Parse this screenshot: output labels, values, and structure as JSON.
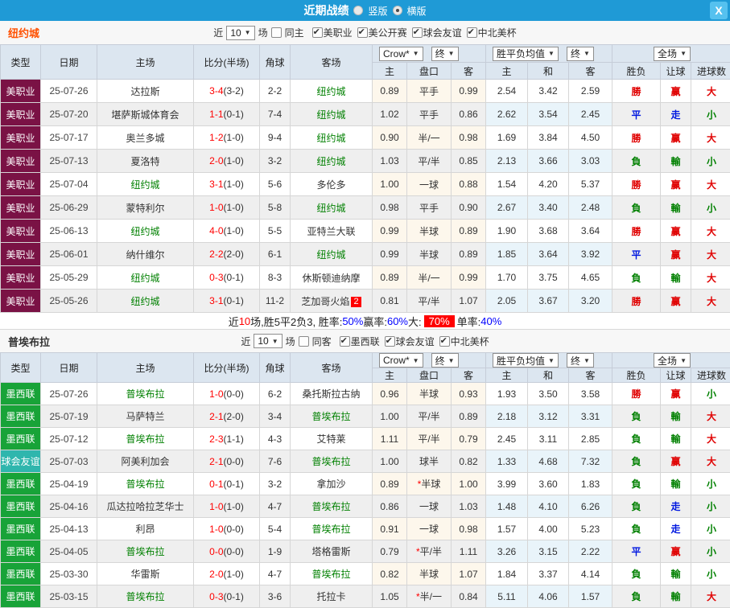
{
  "colors": {
    "titlebar_bg": "#1F9AD6",
    "close_bg": "#55C1EF",
    "header_bg": "#DCE6F0",
    "type_mls": "#7A1245",
    "type_ligamx": "#18A338",
    "type_friendly": "#2FB6AD",
    "team_highlight": "#008000",
    "score_red": "#FF0000",
    "win_red": "#E00000",
    "draw_blue": "#0018E0",
    "lose_green": "#008000",
    "rate_blue": "#0000FF",
    "big_rate_badge_bg": "#FF0000"
  },
  "titlebar": {
    "title": "近期战绩",
    "vertical_label": "竖版",
    "vertical_checked": false,
    "horizontal_label": "横版",
    "horizontal_checked": true,
    "close_glyph": "X"
  },
  "table_header": {
    "cols": [
      "类型",
      "日期",
      "主场",
      "比分(半场)",
      "角球",
      "客场"
    ],
    "sub": [
      "主",
      "盘口",
      "客",
      "主",
      "和",
      "客",
      "胜负",
      "让球",
      "进球数"
    ],
    "company_select": "Crow*",
    "final_select": "终",
    "mean_select": "胜平负均值",
    "final_select2": "终",
    "scope_select": "全场"
  },
  "sections": [
    {
      "team": "纽约城",
      "team_color": "#FF5000",
      "filter": {
        "near": "近",
        "count": "10",
        "games": "场",
        "same": "同主",
        "same_checked": false,
        "leagues": [
          {
            "label": "美职业",
            "checked": true
          },
          {
            "label": "美公开赛",
            "checked": true
          },
          {
            "label": "球会友谊",
            "checked": true
          },
          {
            "label": "中北美杯",
            "checked": true
          }
        ]
      },
      "rows": [
        {
          "type": "美职业",
          "tc": "type_mls",
          "date": "25-07-26",
          "home": "达拉斯",
          "home_hl": false,
          "score": "3-4",
          "half": "(3-2)",
          "corner": "2-2",
          "away": "纽约城",
          "away_hl": true,
          "away_badge": "",
          "odds": {
            "h": "0.89",
            "pk": "平手",
            "a": "0.99",
            "star": false
          },
          "means": [
            "2.54",
            "3.42",
            "2.59"
          ],
          "res": [
            [
              "勝",
              "r"
            ],
            [
              "赢",
              "r"
            ],
            [
              "大",
              "r"
            ]
          ]
        },
        {
          "type": "美职业",
          "tc": "type_mls",
          "date": "25-07-20",
          "home": "堪萨斯城体育会",
          "home_hl": false,
          "score": "1-1",
          "half": "(0-1)",
          "corner": "7-4",
          "away": "纽约城",
          "away_hl": true,
          "away_badge": "",
          "odds": {
            "h": "1.02",
            "pk": "平手",
            "a": "0.86",
            "star": false
          },
          "means": [
            "2.62",
            "3.54",
            "2.45"
          ],
          "res": [
            [
              "平",
              "b"
            ],
            [
              "走",
              "b"
            ],
            [
              "小",
              "g"
            ]
          ]
        },
        {
          "type": "美职业",
          "tc": "type_mls",
          "date": "25-07-17",
          "home": "奥兰多城",
          "home_hl": false,
          "score": "1-2",
          "half": "(1-0)",
          "corner": "9-4",
          "away": "纽约城",
          "away_hl": true,
          "away_badge": "",
          "odds": {
            "h": "0.90",
            "pk": "半/一",
            "a": "0.98",
            "star": false
          },
          "means": [
            "1.69",
            "3.84",
            "4.50"
          ],
          "res": [
            [
              "勝",
              "r"
            ],
            [
              "赢",
              "r"
            ],
            [
              "大",
              "r"
            ]
          ]
        },
        {
          "type": "美职业",
          "tc": "type_mls",
          "date": "25-07-13",
          "home": "夏洛特",
          "home_hl": false,
          "score": "2-0",
          "half": "(1-0)",
          "corner": "3-2",
          "away": "纽约城",
          "away_hl": true,
          "away_badge": "",
          "odds": {
            "h": "1.03",
            "pk": "平/半",
            "a": "0.85",
            "star": false
          },
          "means": [
            "2.13",
            "3.66",
            "3.03"
          ],
          "res": [
            [
              "負",
              "g"
            ],
            [
              "輸",
              "g"
            ],
            [
              "小",
              "g"
            ]
          ]
        },
        {
          "type": "美职业",
          "tc": "type_mls",
          "date": "25-07-04",
          "home": "纽约城",
          "home_hl": true,
          "score": "3-1",
          "half": "(1-0)",
          "corner": "5-6",
          "away": "多伦多",
          "away_hl": false,
          "away_badge": "",
          "odds": {
            "h": "1.00",
            "pk": "一球",
            "a": "0.88",
            "star": false
          },
          "means": [
            "1.54",
            "4.20",
            "5.37"
          ],
          "res": [
            [
              "勝",
              "r"
            ],
            [
              "赢",
              "r"
            ],
            [
              "大",
              "r"
            ]
          ]
        },
        {
          "type": "美职业",
          "tc": "type_mls",
          "date": "25-06-29",
          "home": "蒙特利尔",
          "home_hl": false,
          "score": "1-0",
          "half": "(1-0)",
          "corner": "5-8",
          "away": "纽约城",
          "away_hl": true,
          "away_badge": "",
          "odds": {
            "h": "0.98",
            "pk": "平手",
            "a": "0.90",
            "star": false
          },
          "means": [
            "2.67",
            "3.40",
            "2.48"
          ],
          "res": [
            [
              "負",
              "g"
            ],
            [
              "輸",
              "g"
            ],
            [
              "小",
              "g"
            ]
          ]
        },
        {
          "type": "美职业",
          "tc": "type_mls",
          "date": "25-06-13",
          "home": "纽约城",
          "home_hl": true,
          "score": "4-0",
          "half": "(1-0)",
          "corner": "5-5",
          "away": "亚特兰大联",
          "away_hl": false,
          "away_badge": "",
          "odds": {
            "h": "0.99",
            "pk": "半球",
            "a": "0.89",
            "star": false
          },
          "means": [
            "1.90",
            "3.68",
            "3.64"
          ],
          "res": [
            [
              "勝",
              "r"
            ],
            [
              "赢",
              "r"
            ],
            [
              "大",
              "r"
            ]
          ]
        },
        {
          "type": "美职业",
          "tc": "type_mls",
          "date": "25-06-01",
          "home": "纳什维尔",
          "home_hl": false,
          "score": "2-2",
          "half": "(2-0)",
          "corner": "6-1",
          "away": "纽约城",
          "away_hl": true,
          "away_badge": "",
          "odds": {
            "h": "0.99",
            "pk": "半球",
            "a": "0.89",
            "star": false
          },
          "means": [
            "1.85",
            "3.64",
            "3.92"
          ],
          "res": [
            [
              "平",
              "b"
            ],
            [
              "赢",
              "r"
            ],
            [
              "大",
              "r"
            ]
          ]
        },
        {
          "type": "美职业",
          "tc": "type_mls",
          "date": "25-05-29",
          "home": "纽约城",
          "home_hl": true,
          "score": "0-3",
          "half": "(0-1)",
          "corner": "8-3",
          "away": "休斯顿迪纳摩",
          "away_hl": false,
          "away_badge": "",
          "odds": {
            "h": "0.89",
            "pk": "半/一",
            "a": "0.99",
            "star": false
          },
          "means": [
            "1.70",
            "3.75",
            "4.65"
          ],
          "res": [
            [
              "負",
              "g"
            ],
            [
              "輸",
              "g"
            ],
            [
              "大",
              "r"
            ]
          ]
        },
        {
          "type": "美职业",
          "tc": "type_mls",
          "date": "25-05-26",
          "home": "纽约城",
          "home_hl": true,
          "score": "3-1",
          "half": "(0-1)",
          "corner": "11-2",
          "away": "芝加哥火焰",
          "away_hl": false,
          "away_badge": "2",
          "odds": {
            "h": "0.81",
            "pk": "平/半",
            "a": "1.07",
            "star": false
          },
          "means": [
            "2.05",
            "3.67",
            "3.20"
          ],
          "res": [
            [
              "勝",
              "r"
            ],
            [
              "赢",
              "r"
            ],
            [
              "大",
              "r"
            ]
          ]
        }
      ],
      "summary": [
        {
          "t": "近",
          "s": "k"
        },
        {
          "t": "10",
          "s": "r"
        },
        {
          "t": "场,胜5平2负3, 胜率:",
          "s": "k"
        },
        {
          "t": "50%",
          "s": "b"
        },
        {
          "t": " 赢率:",
          "s": "k"
        },
        {
          "t": "60%",
          "s": "b"
        },
        {
          "t": " 大:",
          "s": "k"
        },
        {
          "t": "70%",
          "s": "hl"
        },
        {
          "t": " 单率:",
          "s": "k"
        },
        {
          "t": "40%",
          "s": "b"
        }
      ]
    },
    {
      "team": "普埃布拉",
      "team_color": "#333333",
      "filter": {
        "near": "近",
        "count": "10",
        "games": "场",
        "same": "同客",
        "same_checked": false,
        "leagues": [
          {
            "label": "墨西联",
            "checked": true
          },
          {
            "label": "球会友谊",
            "checked": true
          },
          {
            "label": "中北美杯",
            "checked": true
          }
        ]
      },
      "rows": [
        {
          "type": "墨西联",
          "tc": "type_ligamx",
          "date": "25-07-26",
          "home": "普埃布拉",
          "home_hl": true,
          "score": "1-0",
          "half": "(0-0)",
          "corner": "6-2",
          "away": "桑托斯拉古纳",
          "away_hl": false,
          "away_badge": "",
          "odds": {
            "h": "0.96",
            "pk": "半球",
            "a": "0.93",
            "star": false
          },
          "means": [
            "1.93",
            "3.50",
            "3.58"
          ],
          "res": [
            [
              "勝",
              "r"
            ],
            [
              "赢",
              "r"
            ],
            [
              "小",
              "g"
            ]
          ]
        },
        {
          "type": "墨西联",
          "tc": "type_ligamx",
          "date": "25-07-19",
          "home": "马萨特兰",
          "home_hl": false,
          "score": "2-1",
          "half": "(2-0)",
          "corner": "3-4",
          "away": "普埃布拉",
          "away_hl": true,
          "away_badge": "",
          "odds": {
            "h": "1.00",
            "pk": "平/半",
            "a": "0.89",
            "star": false
          },
          "means": [
            "2.18",
            "3.12",
            "3.31"
          ],
          "res": [
            [
              "負",
              "g"
            ],
            [
              "輸",
              "g"
            ],
            [
              "大",
              "r"
            ]
          ]
        },
        {
          "type": "墨西联",
          "tc": "type_ligamx",
          "date": "25-07-12",
          "home": "普埃布拉",
          "home_hl": true,
          "score": "2-3",
          "half": "(1-1)",
          "corner": "4-3",
          "away": "艾特莱",
          "away_hl": false,
          "away_badge": "",
          "odds": {
            "h": "1.11",
            "pk": "平/半",
            "a": "0.79",
            "star": false
          },
          "means": [
            "2.45",
            "3.11",
            "2.85"
          ],
          "res": [
            [
              "負",
              "g"
            ],
            [
              "輸",
              "g"
            ],
            [
              "大",
              "r"
            ]
          ]
        },
        {
          "type": "球会友谊",
          "tc": "type_friendly",
          "date": "25-07-03",
          "home": "阿美利加会",
          "home_hl": false,
          "score": "2-1",
          "half": "(0-0)",
          "corner": "7-6",
          "away": "普埃布拉",
          "away_hl": true,
          "away_badge": "",
          "odds": {
            "h": "1.00",
            "pk": "球半",
            "a": "0.82",
            "star": false
          },
          "means": [
            "1.33",
            "4.68",
            "7.32"
          ],
          "res": [
            [
              "負",
              "g"
            ],
            [
              "赢",
              "r"
            ],
            [
              "大",
              "r"
            ]
          ]
        },
        {
          "type": "墨西联",
          "tc": "type_ligamx",
          "date": "25-04-19",
          "home": "普埃布拉",
          "home_hl": true,
          "score": "0-1",
          "half": "(0-1)",
          "corner": "3-2",
          "away": "拿加沙",
          "away_hl": false,
          "away_badge": "",
          "odds": {
            "h": "0.89",
            "pk": "半球",
            "a": "1.00",
            "star": true
          },
          "means": [
            "3.99",
            "3.60",
            "1.83"
          ],
          "res": [
            [
              "負",
              "g"
            ],
            [
              "輸",
              "g"
            ],
            [
              "小",
              "g"
            ]
          ]
        },
        {
          "type": "墨西联",
          "tc": "type_ligamx",
          "date": "25-04-16",
          "home": "瓜达拉哈拉芝华士",
          "home_hl": false,
          "score": "1-0",
          "half": "(1-0)",
          "corner": "4-7",
          "away": "普埃布拉",
          "away_hl": true,
          "away_badge": "",
          "odds": {
            "h": "0.86",
            "pk": "一球",
            "a": "1.03",
            "star": false
          },
          "means": [
            "1.48",
            "4.10",
            "6.26"
          ],
          "res": [
            [
              "負",
              "g"
            ],
            [
              "走",
              "b"
            ],
            [
              "小",
              "g"
            ]
          ]
        },
        {
          "type": "墨西联",
          "tc": "type_ligamx",
          "date": "25-04-13",
          "home": "利昂",
          "home_hl": false,
          "score": "1-0",
          "half": "(0-0)",
          "corner": "5-4",
          "away": "普埃布拉",
          "away_hl": true,
          "away_badge": "",
          "odds": {
            "h": "0.91",
            "pk": "一球",
            "a": "0.98",
            "star": false
          },
          "means": [
            "1.57",
            "4.00",
            "5.23"
          ],
          "res": [
            [
              "負",
              "g"
            ],
            [
              "走",
              "b"
            ],
            [
              "小",
              "g"
            ]
          ]
        },
        {
          "type": "墨西联",
          "tc": "type_ligamx",
          "date": "25-04-05",
          "home": "普埃布拉",
          "home_hl": true,
          "score": "0-0",
          "half": "(0-0)",
          "corner": "1-9",
          "away": "塔格雷斯",
          "away_hl": false,
          "away_badge": "",
          "odds": {
            "h": "0.79",
            "pk": "平/半",
            "a": "1.11",
            "star": true
          },
          "means": [
            "3.26",
            "3.15",
            "2.22"
          ],
          "res": [
            [
              "平",
              "b"
            ],
            [
              "赢",
              "r"
            ],
            [
              "小",
              "g"
            ]
          ]
        },
        {
          "type": "墨西联",
          "tc": "type_ligamx",
          "date": "25-03-30",
          "home": "华雷斯",
          "home_hl": false,
          "score": "2-0",
          "half": "(1-0)",
          "corner": "4-7",
          "away": "普埃布拉",
          "away_hl": true,
          "away_badge": "",
          "odds": {
            "h": "0.82",
            "pk": "半球",
            "a": "1.07",
            "star": false
          },
          "means": [
            "1.84",
            "3.37",
            "4.14"
          ],
          "res": [
            [
              "負",
              "g"
            ],
            [
              "輸",
              "g"
            ],
            [
              "小",
              "g"
            ]
          ]
        },
        {
          "type": "墨西联",
          "tc": "type_ligamx",
          "date": "25-03-15",
          "home": "普埃布拉",
          "home_hl": true,
          "score": "0-3",
          "half": "(0-1)",
          "corner": "3-6",
          "away": "托拉卡",
          "away_hl": false,
          "away_badge": "",
          "odds": {
            "h": "1.05",
            "pk": "半/一",
            "a": "0.84",
            "star": true
          },
          "means": [
            "5.11",
            "4.06",
            "1.57"
          ],
          "res": [
            [
              "負",
              "g"
            ],
            [
              "輸",
              "g"
            ],
            [
              "大",
              "r"
            ]
          ]
        }
      ],
      "summary": []
    }
  ]
}
